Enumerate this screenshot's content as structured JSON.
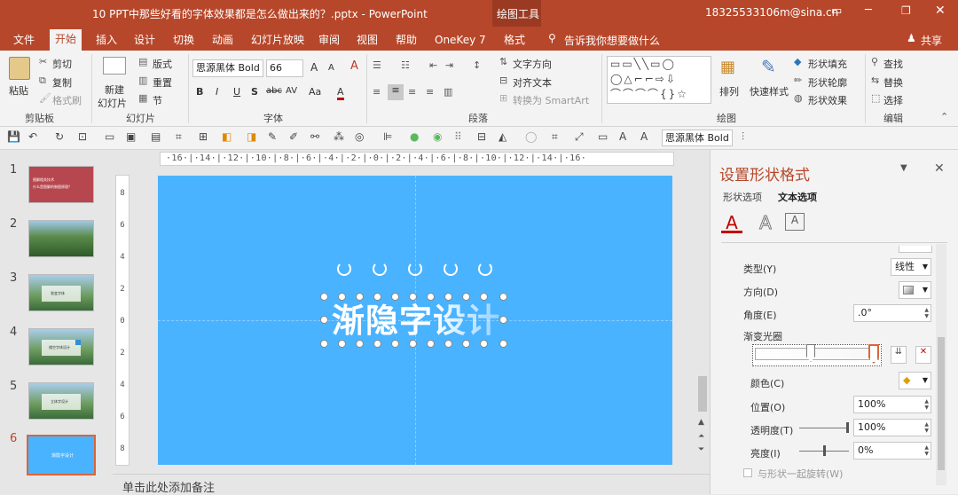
{
  "titlebar": {
    "title": "10 PPT中那些好看的字体效果都是怎么做出来的？.pptx  -  PowerPoint",
    "context_tab": "绘图工具",
    "account": "18325533106m@sina.cn"
  },
  "tabs": [
    "文件",
    "开始",
    "插入",
    "设计",
    "切换",
    "动画",
    "幻灯片放映",
    "审阅",
    "视图",
    "帮助",
    "OneKey 7",
    "格式"
  ],
  "tell_me": "告诉我你想要做什么",
  "share": "共享",
  "ribbon": {
    "clipboard": {
      "paste": "粘贴",
      "cut": "剪切",
      "copy": "复制",
      "format_painter": "格式刷",
      "group": "剪贴板"
    },
    "slides": {
      "new_slide": "新建",
      "new_slide2": "幻灯片",
      "layout": "版式",
      "reset": "重置",
      "section": "节",
      "group": "幻灯片"
    },
    "font": {
      "name": "思源黑体 Bold",
      "size": "66",
      "group": "字体",
      "bold": "B",
      "italic": "I",
      "underline": "U",
      "shadow": "S",
      "strike": "abc",
      "spacing": "AV",
      "case": "Aa",
      "color": "A"
    },
    "paragraph": {
      "text_direction": "文字方向",
      "align_text": "对齐文本",
      "smartart": "转换为 SmartArt",
      "group": "段落"
    },
    "drawing": {
      "arrange": "排列",
      "quick_styles": "快速样式",
      "fill": "形状填充",
      "outline": "形状轮廓",
      "effects": "形状效果",
      "group": "绘图"
    },
    "editing": {
      "find": "查找",
      "replace": "替换",
      "select": "选择",
      "group": "编辑"
    }
  },
  "qat": {
    "font_combo": "思源黑体 Bold"
  },
  "ruler": {
    "h": "·16·|·14·|·12·|·10·|·8·|·6·|·4·|·2·|·0·|·2·|·4·|·6·|·8·|·10·|·12·|·14·|·16·",
    "v": [
      "8",
      "6",
      "4",
      "2",
      "0",
      "2",
      "4",
      "6",
      "8"
    ]
  },
  "thumbs": [
    {
      "num": "1",
      "line1": "图解相关技术",
      "line2": "什么是图解的制图原理？"
    },
    {
      "num": "2"
    },
    {
      "num": "3",
      "caption": "渐变字体"
    },
    {
      "num": "4",
      "caption": "镂空字体设计"
    },
    {
      "num": "5",
      "caption": "立体字设计"
    },
    {
      "num": "6",
      "caption": "渐隐字设计"
    }
  ],
  "slide": {
    "text": "渐隐字设计"
  },
  "notes": "单击此处添加备注",
  "pane": {
    "title": "设置形状格式",
    "tab_shape": "形状选项",
    "tab_text": "文本选项",
    "type_label": "类型(Y)",
    "type_value": "线性",
    "direction_label": "方向(D)",
    "angle_label": "角度(E)",
    "angle_value": ".0°",
    "stops_label": "渐变光圈",
    "color_label": "颜色(C)",
    "position_label": "位置(O)",
    "position_value": "100%",
    "transparency_label": "透明度(T)",
    "transparency_value": "100%",
    "brightness_label": "亮度(I)",
    "brightness_value": "0%",
    "rotate_label": "与形状一起旋转(W)"
  },
  "colors": {
    "brand": "#b7472a",
    "slide_bg": "#4ab3ff"
  }
}
